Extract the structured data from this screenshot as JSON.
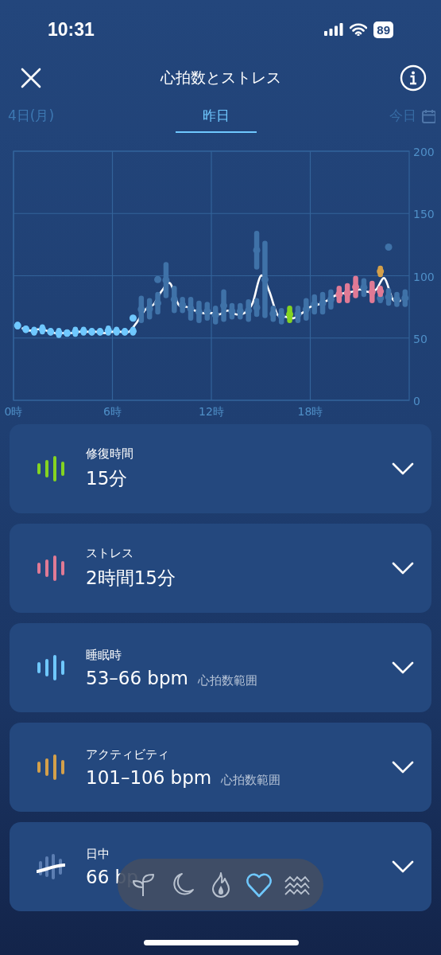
{
  "status_bar": {
    "time": "10:31",
    "battery": "89"
  },
  "header": {
    "title": "心拍数とストレス"
  },
  "date_tabs": [
    {
      "label": "4日(月)",
      "selected": false,
      "kind": "plain"
    },
    {
      "label": "昨日",
      "selected": true,
      "kind": "plain"
    },
    {
      "label": "今日",
      "selected": false,
      "kind": "calendar"
    }
  ],
  "chart": {
    "chart_data": {
      "type": "scatter",
      "xlim": [
        0,
        24
      ],
      "ylim": [
        0,
        200
      ],
      "grid": true,
      "xticks": [
        {
          "value": 0,
          "label": "0時"
        },
        {
          "value": 6,
          "label": "6時"
        },
        {
          "value": 12,
          "label": "12時"
        },
        {
          "value": 18,
          "label": "18時"
        }
      ],
      "yticks": [
        0,
        50,
        100,
        150,
        200
      ],
      "x": [
        0.25,
        0.75,
        1.25,
        1.75,
        2.25,
        2.75,
        3.25,
        3.75,
        4.25,
        4.75,
        5.25,
        5.75,
        6.25,
        6.75,
        7.25,
        7.75,
        8.25,
        8.75,
        9.25,
        9.75,
        10.25,
        10.75,
        11.25,
        11.75,
        12.25,
        12.75,
        13.25,
        13.75,
        14.25,
        14.75,
        15.25,
        15.75,
        16.25,
        16.75,
        17.25,
        17.75,
        18.25,
        18.75,
        19.25,
        19.75,
        20.25,
        20.75,
        21.25,
        21.75,
        22.25,
        22.75,
        23.25,
        23.75
      ],
      "series": [
        {
          "color": "#6fc8ff",
          "values": [
            60,
            57,
            55.5,
            57,
            55,
            54,
            54,
            55,
            55.5,
            55,
            55,
            56,
            55.5,
            55,
            55.5,
            null,
            null,
            null,
            null,
            null,
            null,
            null,
            null,
            null,
            null,
            null,
            null,
            null,
            null,
            null,
            null,
            null,
            null,
            null,
            null,
            null,
            null,
            null,
            null,
            null,
            null,
            null,
            null,
            null,
            null,
            null,
            null,
            null
          ],
          "errors": [
            1,
            1,
            1.5,
            2,
            1,
            2,
            1,
            2,
            1.5,
            1,
            1,
            2,
            1.5,
            1,
            1.5,
            null,
            null,
            null,
            null,
            null,
            null,
            null,
            null,
            null,
            null,
            null,
            null,
            null,
            null,
            null,
            null,
            null,
            null,
            null,
            null,
            null,
            null,
            null,
            null,
            null,
            null,
            null,
            null,
            null,
            null,
            null,
            null,
            null
          ]
        },
        {
          "color": "#6fc8ff",
          "values": [
            null,
            null,
            null,
            null,
            null,
            null,
            null,
            null,
            null,
            null,
            null,
            null,
            null,
            null,
            66,
            null,
            null,
            null,
            null,
            null,
            null,
            null,
            null,
            null,
            null,
            null,
            null,
            null,
            null,
            null,
            null,
            null,
            null,
            null,
            null,
            null,
            null,
            null,
            null,
            null,
            null,
            null,
            null,
            null,
            null,
            null,
            null,
            null
          ],
          "errors": [
            null,
            null,
            null,
            null,
            null,
            null,
            null,
            null,
            null,
            null,
            null,
            null,
            null,
            null,
            0,
            null,
            null,
            null,
            null,
            null,
            null,
            null,
            null,
            null,
            null,
            null,
            null,
            null,
            null,
            null,
            null,
            null,
            null,
            null,
            null,
            null,
            null,
            null,
            null,
            null,
            null,
            null,
            null,
            null,
            null,
            null,
            null,
            null
          ]
        },
        {
          "color": "#3f72a8",
          "values": [
            null,
            null,
            null,
            null,
            null,
            null,
            null,
            null,
            null,
            null,
            null,
            null,
            null,
            null,
            null,
            73,
            73.5,
            78,
            96.5,
            81,
            76.5,
            73.5,
            71,
            71.5,
            68.5,
            76,
            71.5,
            71.5,
            72,
            74.5,
            97,
            69.5,
            67.5,
            null,
            69,
            73,
            77,
            78,
            81,
            null,
            null,
            null,
            90.5,
            null,
            82,
            83,
            81,
            82
          ],
          "errors": [
            null,
            null,
            null,
            null,
            null,
            null,
            null,
            null,
            null,
            null,
            null,
            null,
            null,
            null,
            null,
            9,
            6.5,
            7,
            12.5,
            9,
            4.5,
            7.5,
            7,
            5.5,
            5.5,
            11,
            4.5,
            4.5,
            7,
            5.5,
            29,
            4.5,
            4.5,
            null,
            5,
            7,
            6,
            7,
            6,
            null,
            null,
            null,
            5.5,
            null,
            2,
            5,
            4,
            5
          ]
        },
        {
          "color": "#3f72a8",
          "values": [
            null,
            null,
            null,
            null,
            null,
            null,
            null,
            null,
            null,
            null,
            null,
            null,
            null,
            null,
            null,
            null,
            null,
            97,
            null,
            null,
            null,
            null,
            null,
            null,
            null,
            null,
            null,
            null,
            null,
            120.5,
            null,
            null,
            null,
            null,
            null,
            null,
            null,
            null,
            null,
            null,
            null,
            null,
            null,
            null,
            null,
            123,
            null,
            null
          ],
          "errors": [
            null,
            null,
            null,
            null,
            null,
            null,
            null,
            null,
            null,
            null,
            null,
            null,
            null,
            null,
            null,
            null,
            null,
            0,
            null,
            null,
            null,
            null,
            null,
            null,
            null,
            null,
            null,
            null,
            null,
            13.5,
            null,
            null,
            null,
            null,
            null,
            null,
            null,
            null,
            null,
            null,
            null,
            null,
            null,
            null,
            null,
            0,
            null,
            null
          ]
        },
        {
          "color": "#84d421",
          "values": [
            null,
            null,
            null,
            null,
            null,
            null,
            null,
            null,
            null,
            null,
            null,
            null,
            null,
            null,
            null,
            null,
            null,
            null,
            null,
            null,
            null,
            null,
            null,
            null,
            null,
            null,
            null,
            null,
            null,
            null,
            null,
            null,
            null,
            69,
            null,
            null,
            null,
            null,
            null,
            null,
            null,
            null,
            null,
            null,
            null,
            null,
            null,
            null
          ],
          "errors": [
            null,
            null,
            null,
            null,
            null,
            null,
            null,
            null,
            null,
            null,
            null,
            null,
            null,
            null,
            null,
            null,
            null,
            null,
            null,
            null,
            null,
            null,
            null,
            null,
            null,
            null,
            null,
            null,
            null,
            null,
            null,
            null,
            null,
            5,
            null,
            null,
            null,
            null,
            null,
            null,
            null,
            null,
            null,
            null,
            null,
            null,
            null,
            null
          ]
        },
        {
          "color": "#e07a95",
          "values": [
            null,
            null,
            null,
            null,
            null,
            null,
            null,
            null,
            null,
            null,
            null,
            null,
            null,
            null,
            null,
            null,
            null,
            null,
            null,
            null,
            null,
            null,
            null,
            null,
            null,
            null,
            null,
            null,
            null,
            null,
            null,
            null,
            null,
            null,
            null,
            null,
            null,
            null,
            null,
            85,
            86,
            91,
            null,
            87,
            87.5,
            null,
            null,
            null
          ],
          "errors": [
            null,
            null,
            null,
            null,
            null,
            null,
            null,
            null,
            null,
            null,
            null,
            null,
            null,
            null,
            null,
            null,
            null,
            null,
            null,
            null,
            null,
            null,
            null,
            null,
            null,
            null,
            null,
            null,
            null,
            null,
            null,
            null,
            null,
            null,
            null,
            null,
            null,
            null,
            null,
            5,
            6,
            7,
            null,
            7,
            2.5,
            null,
            null,
            null
          ]
        },
        {
          "color": "#d4a04a",
          "values": [
            null,
            null,
            null,
            null,
            null,
            null,
            null,
            null,
            null,
            null,
            null,
            null,
            null,
            null,
            null,
            null,
            null,
            null,
            null,
            null,
            null,
            null,
            null,
            null,
            null,
            null,
            null,
            null,
            null,
            null,
            null,
            null,
            null,
            null,
            null,
            null,
            null,
            null,
            null,
            null,
            null,
            null,
            null,
            null,
            103.5,
            null,
            null,
            null
          ],
          "errors": [
            null,
            null,
            null,
            null,
            null,
            null,
            null,
            null,
            null,
            null,
            null,
            null,
            null,
            null,
            null,
            null,
            null,
            null,
            null,
            null,
            null,
            null,
            null,
            null,
            null,
            null,
            null,
            null,
            null,
            null,
            null,
            null,
            null,
            null,
            null,
            null,
            null,
            null,
            null,
            null,
            null,
            null,
            null,
            null,
            2.5,
            null,
            null,
            null
          ]
        },
        {
          "type": "line",
          "color": "#ffffff",
          "x": [
            0.5,
            1,
            1.5,
            2,
            2.5,
            3,
            3.5,
            4,
            4.5,
            5,
            5.5,
            6,
            6.5,
            7,
            7.5,
            8,
            8.5,
            9,
            9.5,
            10,
            10.5,
            11,
            11.5,
            12,
            12.5,
            13,
            13.5,
            14,
            14.5,
            15,
            15.5,
            16,
            16.5,
            17,
            17.5,
            18,
            18.5,
            19,
            19.5,
            20,
            20.5,
            21,
            21.5,
            22,
            22.5,
            23,
            23.5
          ],
          "values": [
            58,
            56,
            57,
            56,
            54,
            54,
            54,
            55,
            55,
            55,
            54,
            55,
            55,
            55,
            63,
            73,
            77,
            88,
            94,
            77,
            75,
            72,
            70,
            70,
            69,
            72,
            69,
            70,
            78,
            100,
            88,
            69,
            67,
            66,
            70,
            75,
            77,
            80,
            84,
            86,
            87,
            89,
            87,
            89,
            98,
            81,
            80
          ]
        }
      ]
    }
  },
  "cards": [
    {
      "kind": "bars",
      "color": "#84d421",
      "label": "修復時間",
      "value": "15分"
    },
    {
      "kind": "bars",
      "color": "#e07a95",
      "label": "ストレス",
      "value": "2時間15分"
    },
    {
      "kind": "bars",
      "color": "#6fc8ff",
      "label": "睡眠時",
      "value": "53–66 bpm",
      "note": "心拍数範囲"
    },
    {
      "kind": "bars",
      "color": "#d4a04a",
      "label": "アクティビティ",
      "value": "101–106 bpm",
      "note": "心拍数範囲"
    },
    {
      "kind": "wave",
      "color": "#6a8cc0",
      "label": "日中",
      "value": "66 bp"
    }
  ],
  "bottom_nav": [
    {
      "selected": false
    },
    {
      "selected": false
    },
    {
      "selected": false
    },
    {
      "selected": true
    },
    {
      "selected": false
    }
  ]
}
